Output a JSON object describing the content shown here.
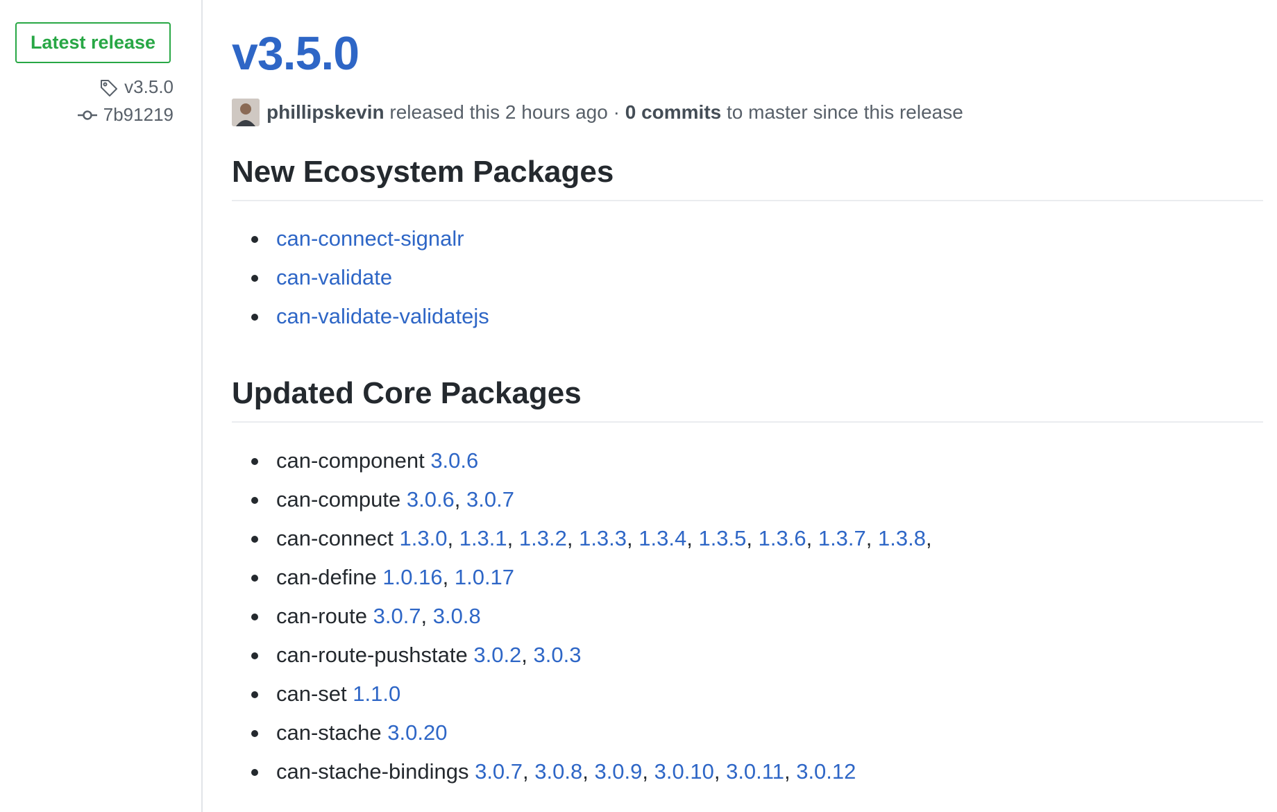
{
  "sidebar": {
    "badge_label": "Latest release",
    "tag": "v3.5.0",
    "commit": "7b91219"
  },
  "release": {
    "title": "v3.5.0",
    "author": "phillipskevin",
    "released_text": "released this 2 hours ago",
    "dot": "·",
    "commits_count": "0 commits",
    "commits_suffix": "to master since this release"
  },
  "sections": {
    "ecosystem": {
      "heading": "New Ecosystem Packages",
      "items": [
        "can-connect-signalr",
        "can-validate",
        "can-validate-validatejs"
      ]
    },
    "core": {
      "heading": "Updated Core Packages",
      "items": [
        {
          "name": "can-component",
          "versions": [
            "3.0.6"
          ],
          "trailing": ""
        },
        {
          "name": "can-compute",
          "versions": [
            "3.0.6",
            "3.0.7"
          ],
          "trailing": ""
        },
        {
          "name": "can-connect",
          "versions": [
            "1.3.0",
            "1.3.1",
            "1.3.2",
            "1.3.3",
            "1.3.4",
            "1.3.5",
            "1.3.6",
            "1.3.7",
            "1.3.8"
          ],
          "trailing": ","
        },
        {
          "name": "can-define",
          "versions": [
            "1.0.16",
            "1.0.17"
          ],
          "trailing": ""
        },
        {
          "name": "can-route",
          "versions": [
            "3.0.7",
            "3.0.8"
          ],
          "trailing": ""
        },
        {
          "name": "can-route-pushstate",
          "versions": [
            "3.0.2",
            "3.0.3"
          ],
          "trailing": ""
        },
        {
          "name": "can-set",
          "versions": [
            "1.1.0"
          ],
          "trailing": ""
        },
        {
          "name": "can-stache",
          "versions": [
            "3.0.20"
          ],
          "trailing": ""
        },
        {
          "name": "can-stache-bindings",
          "versions": [
            "3.0.7",
            "3.0.8",
            "3.0.9",
            "3.0.10",
            "3.0.11",
            "3.0.12"
          ],
          "trailing": ""
        }
      ]
    }
  },
  "colors": {
    "link": "#2e66c6",
    "badge_green": "#28a745",
    "muted": "#586069"
  },
  "icons": {
    "tag": "tag-icon",
    "commit": "git-commit-icon"
  }
}
